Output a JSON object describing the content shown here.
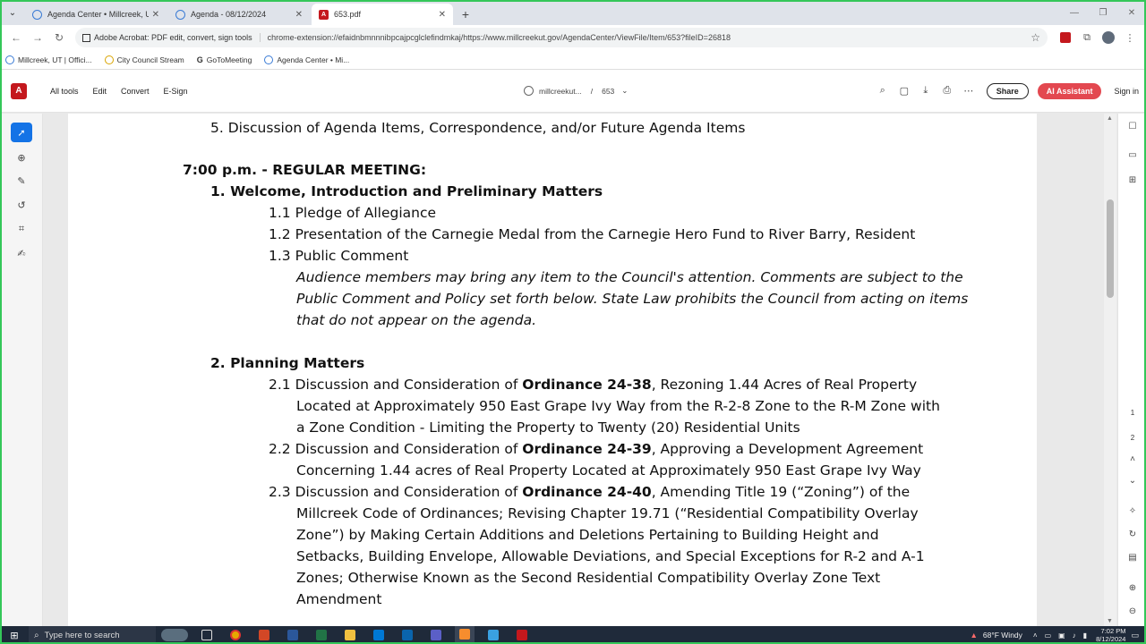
{
  "browser": {
    "tabs": [
      {
        "label": "Agenda Center • Millcreek, UT",
        "icon": "globe-icon",
        "active": false
      },
      {
        "label": "Agenda - 08/12/2024",
        "icon": "globe-icon",
        "active": false
      },
      {
        "label": "653.pdf",
        "icon": "acrobat-icon",
        "active": true
      }
    ],
    "new_tab": "+",
    "extension_chip": "Adobe Acrobat: PDF edit, convert, sign tools",
    "url": "chrome-extension://efaidnbmnnnibpcajpcglclefindmkaj/https://www.millcreekut.gov/AgendaCenter/ViewFile/Item/653?fileID=26818",
    "bookmarks": [
      {
        "label": "Millcreek, UT | Offici...",
        "icon": "globe-icon"
      },
      {
        "label": "City Council Stream",
        "icon": "stream-icon"
      },
      {
        "label": "GoToMeeting",
        "icon": "g-icon"
      },
      {
        "label": "Agenda Center • Mi...",
        "icon": "globe-icon"
      }
    ]
  },
  "acrobat": {
    "menu": [
      "All tools",
      "Edit",
      "Convert",
      "E-Sign"
    ],
    "breadcrumb": {
      "site": "millcreekut...",
      "separator": "/",
      "file": "653"
    },
    "share_label": "Share",
    "ai_label": "AI Assistant",
    "signin_label": "Sign in",
    "page_indicators": [
      "1",
      "2"
    ],
    "accent": "#c4181d"
  },
  "document": {
    "item5": "5.  Discussion of Agenda Items, Correspondence, and/or Future Agenda Items",
    "regular_meeting": "7:00 p.m. - REGULAR MEETING:",
    "section1": "1. Welcome, Introduction and Preliminary Matters",
    "item1_1": "1.1 Pledge of Allegiance",
    "item1_2": "1.2 Presentation of the Carnegie Medal from the Carnegie Hero Fund to River Barry, Resident",
    "item1_3": "1.3 Public Comment",
    "public_comment_lines": [
      "Audience members may bring any item to the Council's attention. Comments are subject to the",
      "Public Comment and Policy set forth below. State Law prohibits the Council from acting on items",
      "that do not appear on the agenda."
    ],
    "section2": "2. Planning Matters",
    "item2_1": {
      "prefix": "2.1 Discussion and Consideration of ",
      "ordinance": "Ordinance 24-38",
      "rest": ", Rezoning 1.44 Acres of Real Property",
      "lines": [
        "Located at Approximately 950 East Grape Ivy Way from the R-2-8 Zone to the R-M Zone with",
        "a Zone Condition - Limiting the Property to Twenty (20) Residential Units"
      ]
    },
    "item2_2": {
      "prefix": "2.2 Discussion and Consideration of ",
      "ordinance": "Ordinance 24-39",
      "rest": ", Approving a Development Agreement",
      "lines": [
        "Concerning 1.44 acres of Real Property Located at Approximately 950 East Grape Ivy Way"
      ]
    },
    "item2_3": {
      "prefix": "2.3 Discussion and Consideration of ",
      "ordinance": "Ordinance 24-40",
      "rest": ", Amending Title 19 (“Zoning”) of the",
      "lines": [
        "Millcreek Code of Ordinances; Revising Chapter 19.71 (“Residential Compatibility Overlay",
        "Zone”) by Making Certain Additions and Deletions Pertaining to Building Height and",
        "Setbacks, Building Envelope, Allowable Deviations, and Special Exceptions for R-2 and A-1",
        "Zones; Otherwise Known as the Second Residential Compatibility Overlay Zone Text",
        "Amendment"
      ]
    }
  },
  "taskbar": {
    "search_placeholder": "Type here to search",
    "weather": "68°F  Windy",
    "time": "7:02 PM",
    "date": "8/12/2024"
  }
}
